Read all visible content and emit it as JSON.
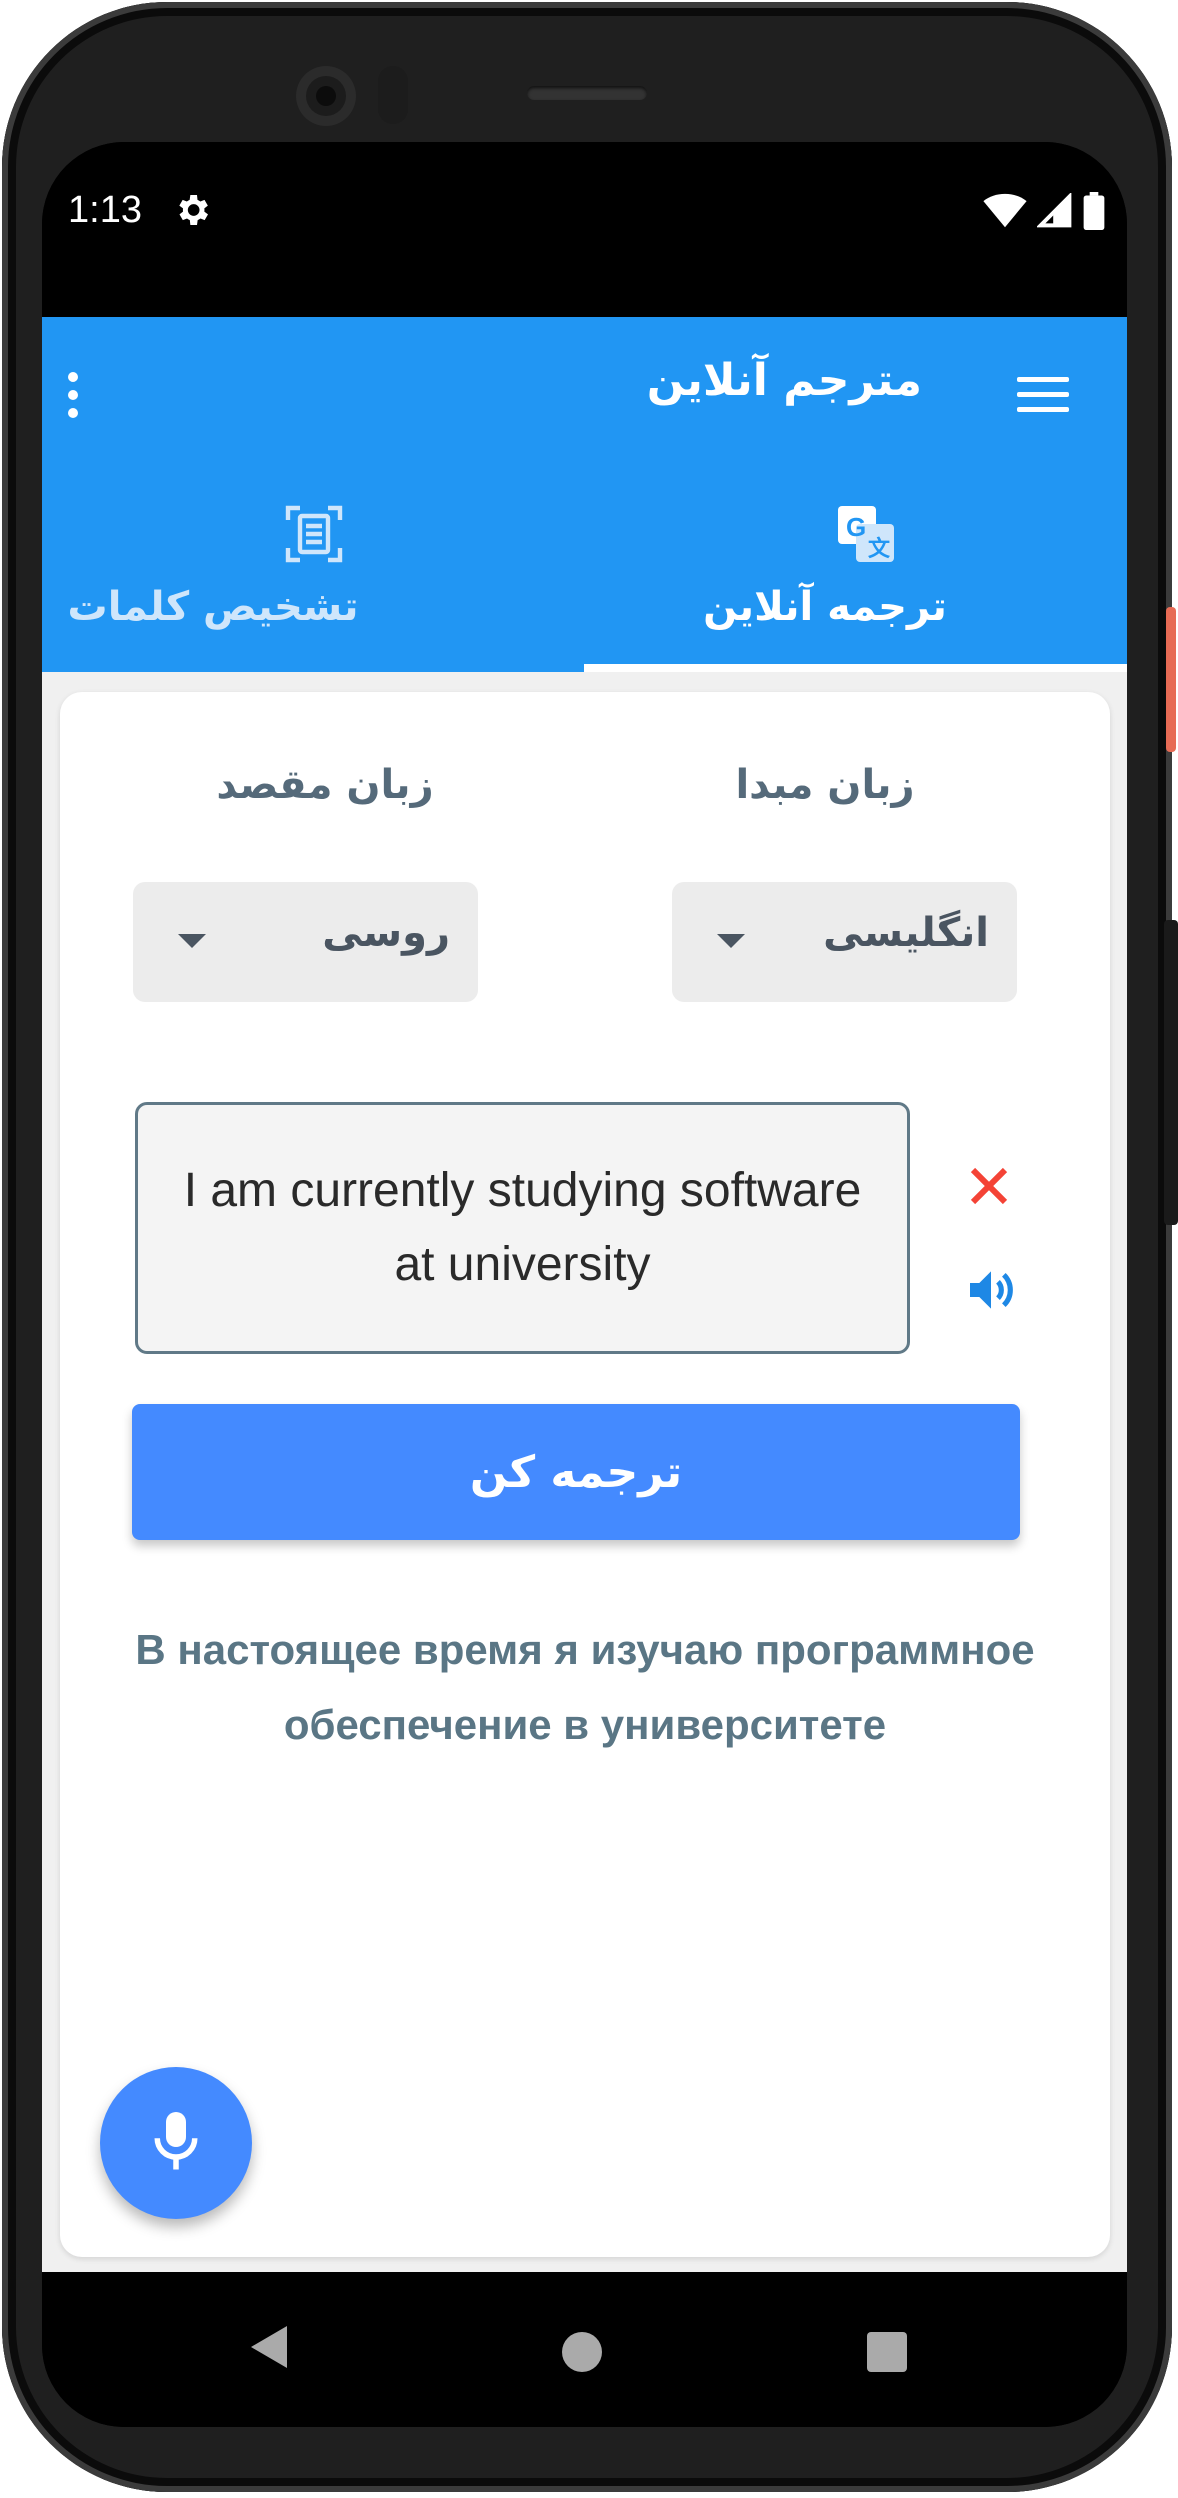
{
  "status_bar": {
    "time": "1:13"
  },
  "app_bar": {
    "title": "مترجم آنلاین"
  },
  "tabs": [
    {
      "label": "تشخیص کلمات",
      "icon": "document-scan-icon",
      "selected": false
    },
    {
      "label": "ترجمه آنلاین",
      "icon": "google-translate-icon",
      "selected": true
    }
  ],
  "translator": {
    "source_label": "زبان مبدا",
    "target_label": "زبان مقصد",
    "source_language": "انگلیسی",
    "target_language": "روسی",
    "input_text": "I am currently studying software at university",
    "translate_button": "ترجمه کن",
    "result_text": "В настоящее время я изучаю программное обеспечение в университете"
  },
  "colors": {
    "primary": "#2196f3",
    "accent": "#448aff",
    "clear_icon": "#f44336",
    "speaker_icon": "#1e88e5",
    "result_text": "#5a7685"
  }
}
